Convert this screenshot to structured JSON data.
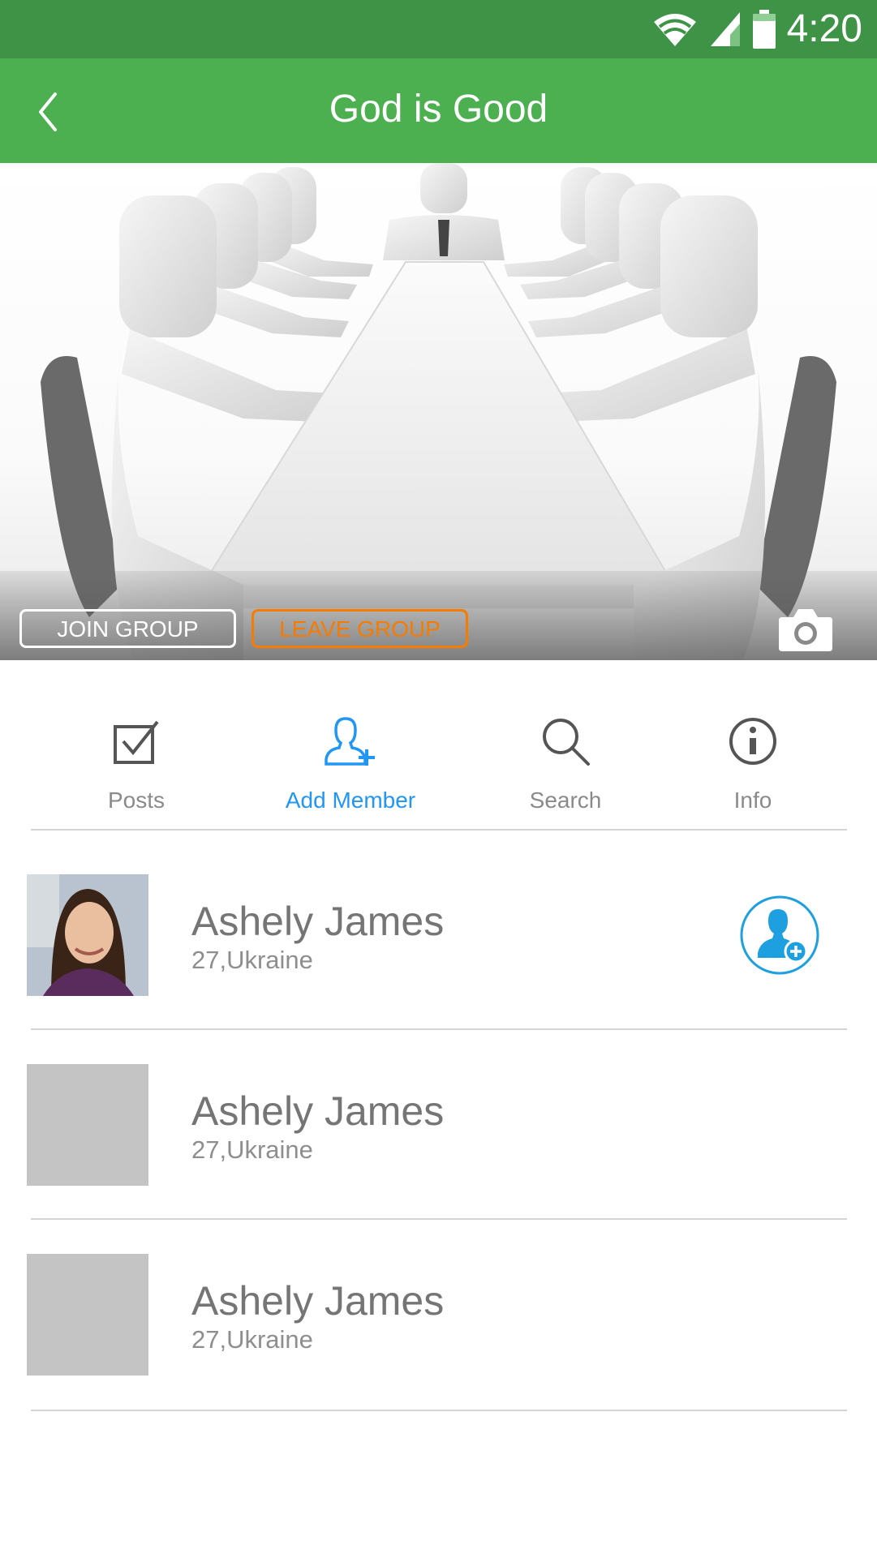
{
  "status_bar": {
    "time": "4:20",
    "icons": [
      "wifi-icon",
      "signal-icon",
      "battery-icon"
    ]
  },
  "header": {
    "title": "God is Good",
    "back_icon": "chevron-left-icon"
  },
  "cover": {
    "image": "conference-table-illustration",
    "join_label": "JOIN GROUP",
    "leave_label": "LEAVE GROUP",
    "camera_icon": "camera-icon"
  },
  "tabs": [
    {
      "label": "Posts",
      "icon": "checkbox-icon",
      "active": false
    },
    {
      "label": "Add Member",
      "icon": "add-user-icon",
      "active": true
    },
    {
      "label": "Search",
      "icon": "search-icon",
      "active": false
    },
    {
      "label": "Info",
      "icon": "info-icon",
      "active": false
    }
  ],
  "members": [
    {
      "name": "Ashely James",
      "meta": "27,Ukraine",
      "has_photo": true,
      "add_icon": "add-user-circle-icon"
    },
    {
      "name": "Ashely James",
      "meta": "27,Ukraine",
      "has_photo": false
    },
    {
      "name": "Ashely James",
      "meta": "27,Ukraine",
      "has_photo": false
    }
  ],
  "colors": {
    "status_bar": "#3e9347",
    "app_bar": "#4caf50",
    "accent_blue": "#2196f3",
    "leave_orange": "#f57c00",
    "placeholder_gray": "#c4c4c4"
  }
}
